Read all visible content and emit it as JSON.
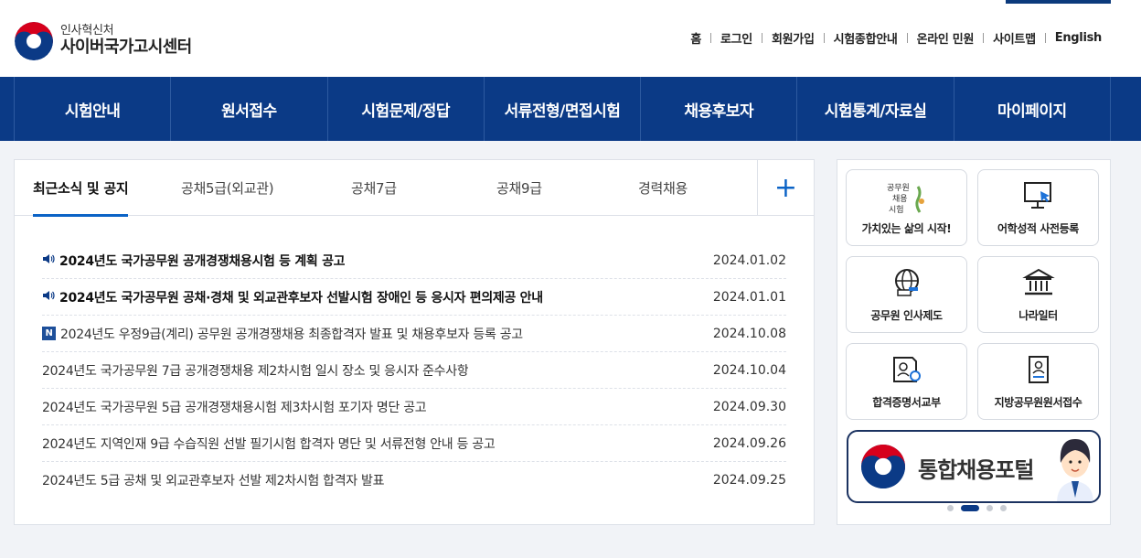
{
  "logo": {
    "sub": "인사혁신처",
    "main": "사이버국가고시센터"
  },
  "util_nav": [
    "홈",
    "로그인",
    "회원가입",
    "시험종합안내",
    "온라인 민원",
    "사이트맵",
    "English"
  ],
  "gnb": [
    "시험안내",
    "원서접수",
    "시험문제/정답",
    "서류전형/면접시험",
    "채용후보자",
    "시험통계/자료실",
    "마이페이지"
  ],
  "tabs": [
    {
      "label": "최근소식 및 공지",
      "active": true
    },
    {
      "label": "공채5급(외교관)"
    },
    {
      "label": "공채7급"
    },
    {
      "label": "공채9급"
    },
    {
      "label": "경력채용"
    }
  ],
  "tab_plus_symbol": "+",
  "notices": [
    {
      "title": "2024년도 국가공무원 공개경쟁채용시험 등 계획 공고",
      "date": "2024.01.02",
      "type": "pinned"
    },
    {
      "title": "2024년도 국가공무원 공채·경채 및 외교관후보자 선발시험 장애인 등 응시자 편의제공 안내",
      "date": "2024.01.01",
      "type": "pinned"
    },
    {
      "title": "2024년도 우정9급(계리) 공무원 공개경쟁채용 최종합격자 발표 및 채용후보자 등록 공고",
      "date": "2024.10.08",
      "type": "new",
      "badge": "N"
    },
    {
      "title": "2024년도 국가공무원 7급 공개경쟁채용 제2차시험 일시 장소 및 응시자 준수사항",
      "date": "2024.10.04",
      "type": "normal"
    },
    {
      "title": "2024년도 국가공무원 5급 공개경쟁채용시험 제3차시험 포기자 명단 공고",
      "date": "2024.09.30",
      "type": "normal"
    },
    {
      "title": "2024년도 지역인재 9급 수습직원 선발 필기시험 합격자 명단 및 서류전형 안내 등 공고",
      "date": "2024.09.26",
      "type": "normal"
    },
    {
      "title": "2024년도 5급 공채 및 외교관후보자 선발 제2차시험 합격자 발표",
      "date": "2024.09.25",
      "type": "normal"
    }
  ],
  "quick_links": [
    {
      "label": "가치있는 삶의 시작!",
      "icon": "civil-service-exam-icon",
      "icon_text": "공무원 채용 시험"
    },
    {
      "label": "어학성적 사전등록",
      "icon": "monitor-cursor-icon"
    },
    {
      "label": "공무원 인사제도",
      "icon": "globe-gavel-icon"
    },
    {
      "label": "나라일터",
      "icon": "government-building-icon"
    },
    {
      "label": "합격증명서교부",
      "icon": "certificate-icon"
    },
    {
      "label": "지방공무원원서접수",
      "icon": "document-person-icon"
    }
  ],
  "banner": {
    "text": "통합채용포털"
  },
  "colors": {
    "primary": "#0b3a86",
    "accent": "#0b63c6",
    "bg": "#f1f3f7"
  }
}
